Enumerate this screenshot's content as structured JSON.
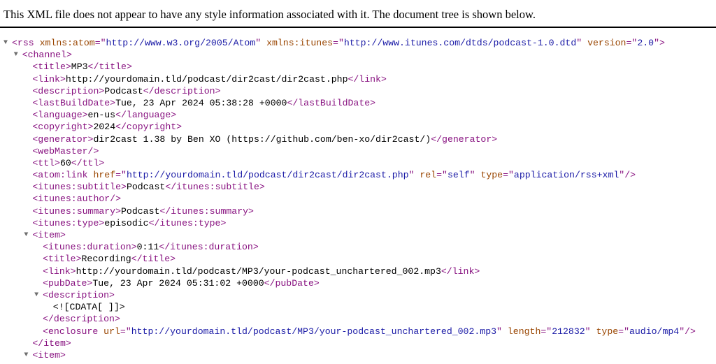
{
  "header": {
    "message": "This XML file does not appear to have any style information associated with it. The document tree is shown below."
  },
  "tree": {
    "arrow_glyph": "▼",
    "lines": [
      {
        "depth": 0,
        "arrow": true,
        "tokens": [
          {
            "k": "t",
            "s": "<rss "
          },
          {
            "k": "a",
            "s": "xmlns:atom"
          },
          {
            "k": "t",
            "s": "=\""
          },
          {
            "k": "v",
            "s": "http://www.w3.org/2005/Atom"
          },
          {
            "k": "t",
            "s": "\" "
          },
          {
            "k": "a",
            "s": "xmlns:itunes"
          },
          {
            "k": "t",
            "s": "=\""
          },
          {
            "k": "v",
            "s": "http://www.itunes.com/dtds/podcast-1.0.dtd"
          },
          {
            "k": "t",
            "s": "\" "
          },
          {
            "k": "a",
            "s": "version"
          },
          {
            "k": "t",
            "s": "=\""
          },
          {
            "k": "v",
            "s": "2.0"
          },
          {
            "k": "t",
            "s": "\">"
          }
        ]
      },
      {
        "depth": 1,
        "arrow": true,
        "tokens": [
          {
            "k": "t",
            "s": "<channel>"
          }
        ]
      },
      {
        "depth": 2,
        "tokens": [
          {
            "k": "t",
            "s": "<title>"
          },
          {
            "k": "x",
            "s": "MP3"
          },
          {
            "k": "t",
            "s": "</title>"
          }
        ]
      },
      {
        "depth": 2,
        "tokens": [
          {
            "k": "t",
            "s": "<link>"
          },
          {
            "k": "x",
            "s": "http://yourdomain.tld/podcast/dir2cast/dir2cast.php"
          },
          {
            "k": "t",
            "s": "</link>"
          }
        ]
      },
      {
        "depth": 2,
        "tokens": [
          {
            "k": "t",
            "s": "<description>"
          },
          {
            "k": "x",
            "s": "Podcast"
          },
          {
            "k": "t",
            "s": "</description>"
          }
        ]
      },
      {
        "depth": 2,
        "tokens": [
          {
            "k": "t",
            "s": "<lastBuildDate>"
          },
          {
            "k": "x",
            "s": "Tue, 23 Apr 2024 05:38:28 +0000"
          },
          {
            "k": "t",
            "s": "</lastBuildDate>"
          }
        ]
      },
      {
        "depth": 2,
        "tokens": [
          {
            "k": "t",
            "s": "<language>"
          },
          {
            "k": "x",
            "s": "en-us"
          },
          {
            "k": "t",
            "s": "</language>"
          }
        ]
      },
      {
        "depth": 2,
        "tokens": [
          {
            "k": "t",
            "s": "<copyright>"
          },
          {
            "k": "x",
            "s": "2024"
          },
          {
            "k": "t",
            "s": "</copyright>"
          }
        ]
      },
      {
        "depth": 2,
        "tokens": [
          {
            "k": "t",
            "s": "<generator>"
          },
          {
            "k": "x",
            "s": "dir2cast 1.38 by Ben XO (https://github.com/ben-xo/dir2cast/)"
          },
          {
            "k": "t",
            "s": "</generator>"
          }
        ]
      },
      {
        "depth": 2,
        "tokens": [
          {
            "k": "t",
            "s": "<webMaster/>"
          }
        ]
      },
      {
        "depth": 2,
        "tokens": [
          {
            "k": "t",
            "s": "<ttl>"
          },
          {
            "k": "x",
            "s": "60"
          },
          {
            "k": "t",
            "s": "</ttl>"
          }
        ]
      },
      {
        "depth": 2,
        "tokens": [
          {
            "k": "t",
            "s": "<atom:link "
          },
          {
            "k": "a",
            "s": "href"
          },
          {
            "k": "t",
            "s": "=\""
          },
          {
            "k": "v",
            "s": "http://yourdomain.tld/podcast/dir2cast/dir2cast.php"
          },
          {
            "k": "t",
            "s": "\" "
          },
          {
            "k": "a",
            "s": "rel"
          },
          {
            "k": "t",
            "s": "=\""
          },
          {
            "k": "v",
            "s": "self"
          },
          {
            "k": "t",
            "s": "\" "
          },
          {
            "k": "a",
            "s": "type"
          },
          {
            "k": "t",
            "s": "=\""
          },
          {
            "k": "v",
            "s": "application/rss+xml"
          },
          {
            "k": "t",
            "s": "\"/>"
          }
        ]
      },
      {
        "depth": 2,
        "tokens": [
          {
            "k": "t",
            "s": "<itunes:subtitle>"
          },
          {
            "k": "x",
            "s": "Podcast"
          },
          {
            "k": "t",
            "s": "</itunes:subtitle>"
          }
        ]
      },
      {
        "depth": 2,
        "tokens": [
          {
            "k": "t",
            "s": "<itunes:author/>"
          }
        ]
      },
      {
        "depth": 2,
        "tokens": [
          {
            "k": "t",
            "s": "<itunes:summary>"
          },
          {
            "k": "x",
            "s": "Podcast"
          },
          {
            "k": "t",
            "s": "</itunes:summary>"
          }
        ]
      },
      {
        "depth": 2,
        "tokens": [
          {
            "k": "t",
            "s": "<itunes:type>"
          },
          {
            "k": "x",
            "s": "episodic"
          },
          {
            "k": "t",
            "s": "</itunes:type>"
          }
        ]
      },
      {
        "depth": 2,
        "arrow": true,
        "tokens": [
          {
            "k": "t",
            "s": "<item>"
          }
        ]
      },
      {
        "depth": 3,
        "tokens": [
          {
            "k": "t",
            "s": "<itunes:duration>"
          },
          {
            "k": "x",
            "s": "0:11"
          },
          {
            "k": "t",
            "s": "</itunes:duration>"
          }
        ]
      },
      {
        "depth": 3,
        "tokens": [
          {
            "k": "t",
            "s": "<title>"
          },
          {
            "k": "x",
            "s": "Recording"
          },
          {
            "k": "t",
            "s": "</title>"
          }
        ]
      },
      {
        "depth": 3,
        "tokens": [
          {
            "k": "t",
            "s": "<link>"
          },
          {
            "k": "x",
            "s": "http://yourdomain.tld/podcast/MP3/your-podcast_unchartered_002.mp3"
          },
          {
            "k": "t",
            "s": "</link>"
          }
        ]
      },
      {
        "depth": 3,
        "tokens": [
          {
            "k": "t",
            "s": "<pubDate>"
          },
          {
            "k": "x",
            "s": "Tue, 23 Apr 2024 05:31:02 +0000"
          },
          {
            "k": "t",
            "s": "</pubDate>"
          }
        ]
      },
      {
        "depth": 3,
        "arrow": true,
        "tokens": [
          {
            "k": "t",
            "s": "<description>"
          }
        ]
      },
      {
        "depth": 4,
        "tokens": [
          {
            "k": "x",
            "s": "<![CDATA[ ]]>"
          }
        ]
      },
      {
        "depth": 3,
        "tokens": [
          {
            "k": "t",
            "s": "</description>"
          }
        ]
      },
      {
        "depth": 3,
        "tokens": [
          {
            "k": "t",
            "s": "<enclosure "
          },
          {
            "k": "a",
            "s": "url"
          },
          {
            "k": "t",
            "s": "=\""
          },
          {
            "k": "v",
            "s": "http://yourdomain.tld/podcast/MP3/your-podcast_unchartered_002.mp3"
          },
          {
            "k": "t",
            "s": "\" "
          },
          {
            "k": "a",
            "s": "length"
          },
          {
            "k": "t",
            "s": "=\""
          },
          {
            "k": "v",
            "s": "212832"
          },
          {
            "k": "t",
            "s": "\" "
          },
          {
            "k": "a",
            "s": "type"
          },
          {
            "k": "t",
            "s": "=\""
          },
          {
            "k": "v",
            "s": "audio/mp4"
          },
          {
            "k": "t",
            "s": "\"/>"
          }
        ]
      },
      {
        "depth": 2,
        "tokens": [
          {
            "k": "t",
            "s": "</item>"
          }
        ]
      },
      {
        "depth": 2,
        "arrow": true,
        "tokens": [
          {
            "k": "t",
            "s": "<item>"
          }
        ]
      }
    ]
  }
}
